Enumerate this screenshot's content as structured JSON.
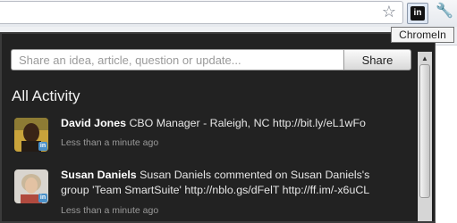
{
  "browser": {
    "extension_tooltip": "ChromeIn",
    "extension_icon_text": "in",
    "icons": {
      "star": "star-icon",
      "extension": "linkedin-icon",
      "wrench": "wrench-icon"
    }
  },
  "popup": {
    "share_placeholder": "Share an idea, article, question or update...",
    "share_button_label": "Share",
    "section_title": "All Activity",
    "activity": [
      {
        "name": "David Jones",
        "text": "CBO Manager - Raleigh, NC http://bit.ly/eL1wFo",
        "time": "Less than a minute ago"
      },
      {
        "name": "Susan Daniels",
        "text": "Susan Daniels commented on Susan Daniels's group 'Team SmartSuite' http://nblo.gs/dFelT http://ff.im/-x6uCL",
        "time": "Less than a minute ago"
      }
    ]
  }
}
